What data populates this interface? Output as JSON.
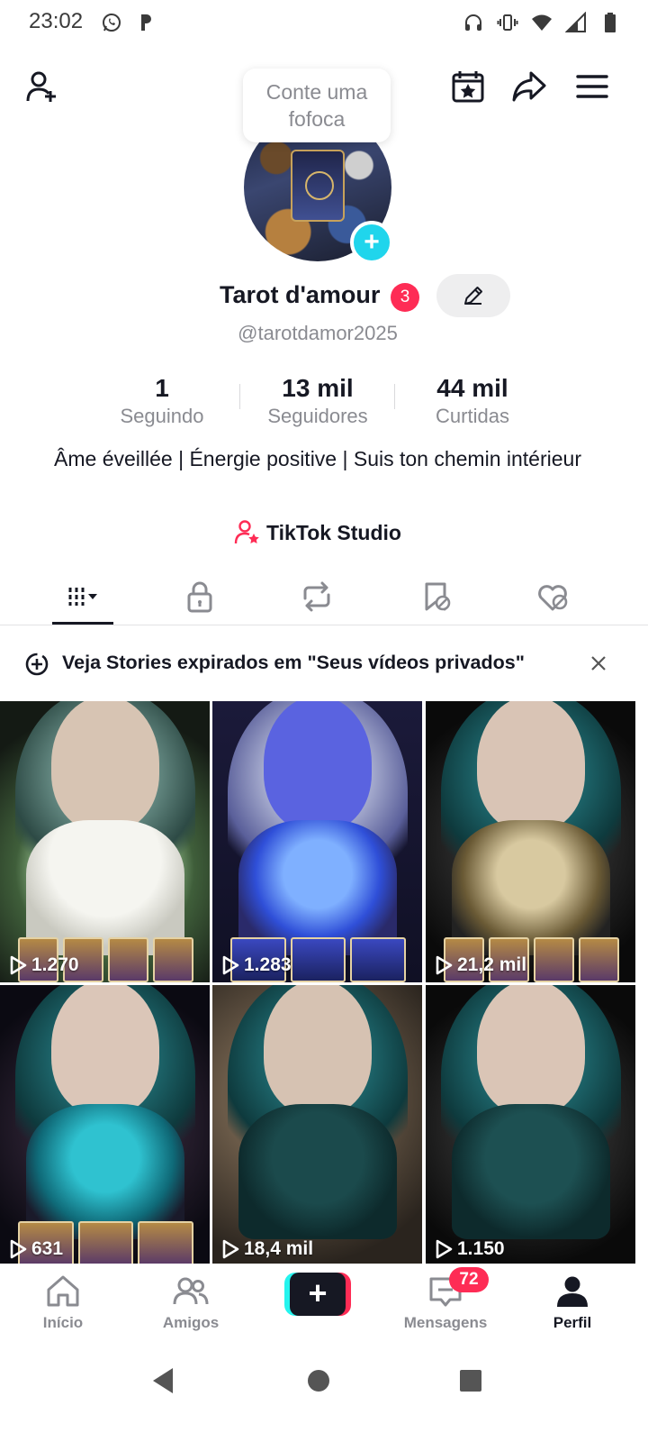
{
  "status_bar": {
    "time": "23:02",
    "left_icons": [
      "whatsapp-icon",
      "notification-icon"
    ],
    "right_icons": [
      "headphones-icon",
      "vibrate-icon",
      "wifi-icon",
      "signal-icon",
      "battery-icon"
    ]
  },
  "top_bar": {
    "icons": [
      "add-friend-icon",
      "calendar-star-icon",
      "share-icon",
      "menu-icon"
    ]
  },
  "bubble": {
    "text": "Conte uma fofoca"
  },
  "profile": {
    "display_name": "Tarot d'amour",
    "name_badge": "3",
    "handle": "@tarotdamor2025",
    "stats": [
      {
        "value": "1",
        "label": "Seguindo"
      },
      {
        "value": "13 mil",
        "label": "Seguidores"
      },
      {
        "value": "44 mil",
        "label": "Curtidas"
      }
    ],
    "bio": "Âme éveillée | Énergie positive | Suis ton chemin intérieur",
    "studio_label": "TikTok Studio"
  },
  "tabs": [
    "videos-grid-icon",
    "lock-icon",
    "repost-icon",
    "bookmark-icon",
    "liked-icon"
  ],
  "notice": {
    "text": "Veja Stories expirados em \"Seus vídeos privados\""
  },
  "videos": [
    {
      "views": "1.270"
    },
    {
      "views": "1.283"
    },
    {
      "views": "21,2 mil"
    },
    {
      "views": "631"
    },
    {
      "views": "18,4 mil"
    },
    {
      "views": "1.150"
    }
  ],
  "bottom_nav": {
    "items": [
      {
        "label": "Início"
      },
      {
        "label": "Amigos"
      },
      {
        "label": "Mensagens",
        "badge": "72"
      },
      {
        "label": "Perfil"
      }
    ]
  },
  "colors": {
    "accent_red": "#fe2c55",
    "accent_cyan": "#20d5ec",
    "text_primary": "#161823",
    "text_secondary": "#8a8b91"
  }
}
